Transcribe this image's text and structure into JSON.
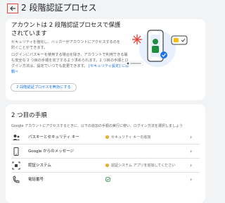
{
  "header": {
    "title": "2 段階認証プロセス"
  },
  "intro": {
    "heading": "アカウントは 2 段階認証プロセスで保護されています",
    "para1": "セキュリティを強化し、ハッカーがアカウントにアクセスするのを防ぐことができます。",
    "para2": "ログインにパスキーを使用する場合を除き、アカウントで利用できる最も安全な 2 つ目の手順を完了するよう求められます。2 つ目の手順とログイン方法は、設定でいつでも変更できます。",
    "link": "[セキュリティ設定] に移動⇨",
    "button": "2 段階認証プロセスを無効にする"
  },
  "steps": {
    "title": "2 つ目の手順",
    "description": "Google アカウントにアクセスするときに、以下の追加の手順の実行に使い、ログイン方法を選択しましょう",
    "items": [
      {
        "icon": "people-icon",
        "label": "パスキーとセキュリティ キー",
        "status": "セキュリティ キーの追加"
      },
      {
        "icon": "phone-icon",
        "label": "Google からのメッセージ",
        "status": ""
      },
      {
        "icon": "authenticator-icon",
        "label": "認証システム",
        "status": "認証システム アプリを追加してください"
      },
      {
        "icon": "phone-icon",
        "label": "電話番号",
        "status": ""
      }
    ]
  },
  "colors": {
    "accent": "#1a73e8",
    "warning": "#e8a317",
    "success": "#1e8e3e",
    "highlight": "#e04a3f"
  }
}
